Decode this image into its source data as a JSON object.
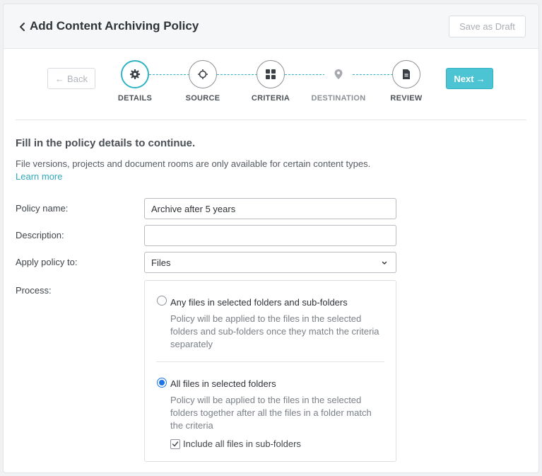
{
  "header": {
    "title": "Add Content Archiving Policy",
    "save_draft_label": "Save as Draft"
  },
  "stepper": {
    "back_label": "Back",
    "next_label": "Next",
    "steps": [
      {
        "label": "DETAILS",
        "icon": "gear-icon",
        "state": "active"
      },
      {
        "label": "SOURCE",
        "icon": "crosshair-icon",
        "state": "default"
      },
      {
        "label": "CRITERIA",
        "icon": "grid-icon",
        "state": "default"
      },
      {
        "label": "DESTINATION",
        "icon": "map-pin-icon",
        "state": "disabled"
      },
      {
        "label": "REVIEW",
        "icon": "document-icon",
        "state": "default"
      }
    ]
  },
  "intro": {
    "heading": "Fill in the policy details to continue.",
    "text": "File versions, projects and document rooms are only available for certain content types.",
    "learn_more": "Learn more"
  },
  "form": {
    "policy_name_label": "Policy name:",
    "policy_name_value": "Archive after 5 years",
    "description_label": "Description:",
    "description_value": "",
    "apply_to_label": "Apply policy to:",
    "apply_to_value": "Files",
    "process_label": "Process:"
  },
  "process": {
    "options": [
      {
        "title": "Any files in selected folders and sub-folders",
        "description": "Policy will be applied to the files in the selected folders and sub-folders once they match the criteria separately",
        "selected": false
      },
      {
        "title": "All files in selected folders",
        "description": "Policy will be applied to the files in the selected folders together after all the files in a folder match the criteria",
        "selected": true
      }
    ],
    "include_subfolders_label": "Include all files in sub-folders",
    "include_subfolders_checked": true
  },
  "colors": {
    "accent": "#4cc4d4",
    "radio_selected": "#1a73e8"
  }
}
